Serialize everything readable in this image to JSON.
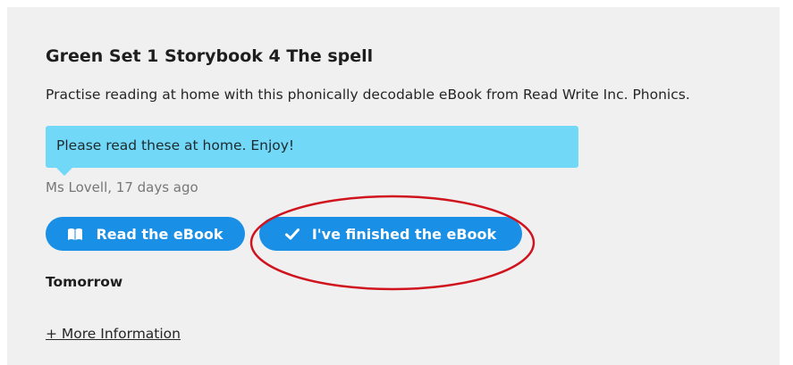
{
  "assignment": {
    "title": "Green Set 1 Storybook 4 The spell",
    "description": "Practise reading at home with this phonically decodable eBook from Read Write Inc. Phonics.",
    "comment": {
      "text": "Please read these at home. Enjoy!",
      "author_meta": "Ms Lovell, 17 days ago"
    },
    "actions": {
      "read_label": "Read the eBook",
      "read_icon": "book-icon",
      "finished_label": "I've finished the eBook",
      "finished_icon": "checkmark-icon"
    },
    "due": "Tomorrow",
    "more_info_link": "+ More Information"
  },
  "colors": {
    "card_background": "#f0f0f0",
    "comment_bubble": "#72d8f7",
    "button_primary": "#1a8fe6",
    "annotation_circle": "#d0141e"
  }
}
